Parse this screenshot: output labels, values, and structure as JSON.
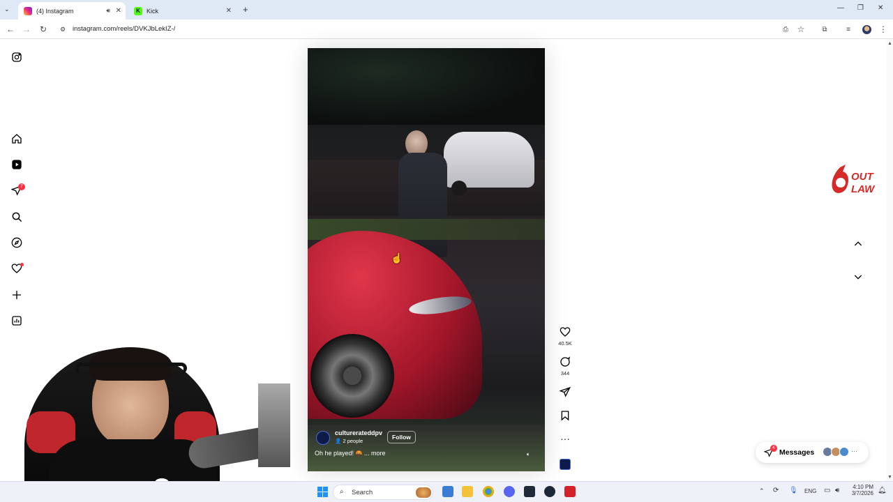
{
  "browser": {
    "tabs": [
      {
        "label": "(4) Instagram",
        "active": true
      },
      {
        "label": "Kick",
        "active": false
      }
    ],
    "new_tab_label": "+",
    "url": "instagram.com/reels/DVKJbLekIZ-/"
  },
  "sidebar": {
    "notifications_badge": "7"
  },
  "reel": {
    "username": "culturerateddpv",
    "collab": "2 people",
    "follow_label": "Follow",
    "caption": "Oh he played!",
    "more_label": "... more",
    "likes": "40.5K",
    "comments": "344"
  },
  "messages": {
    "label": "Messages",
    "badge": "4"
  },
  "outlaw_logo": "OUT LAW",
  "taskbar": {
    "search_placeholder": "Search",
    "lang": "ENG",
    "time": "4:10 PM",
    "date": "3/7/2026"
  },
  "colors": {
    "instagram_red": "#ff3040",
    "chrome_tabbar": "#dfe8f5",
    "outlaw_red": "#d42a2a"
  }
}
